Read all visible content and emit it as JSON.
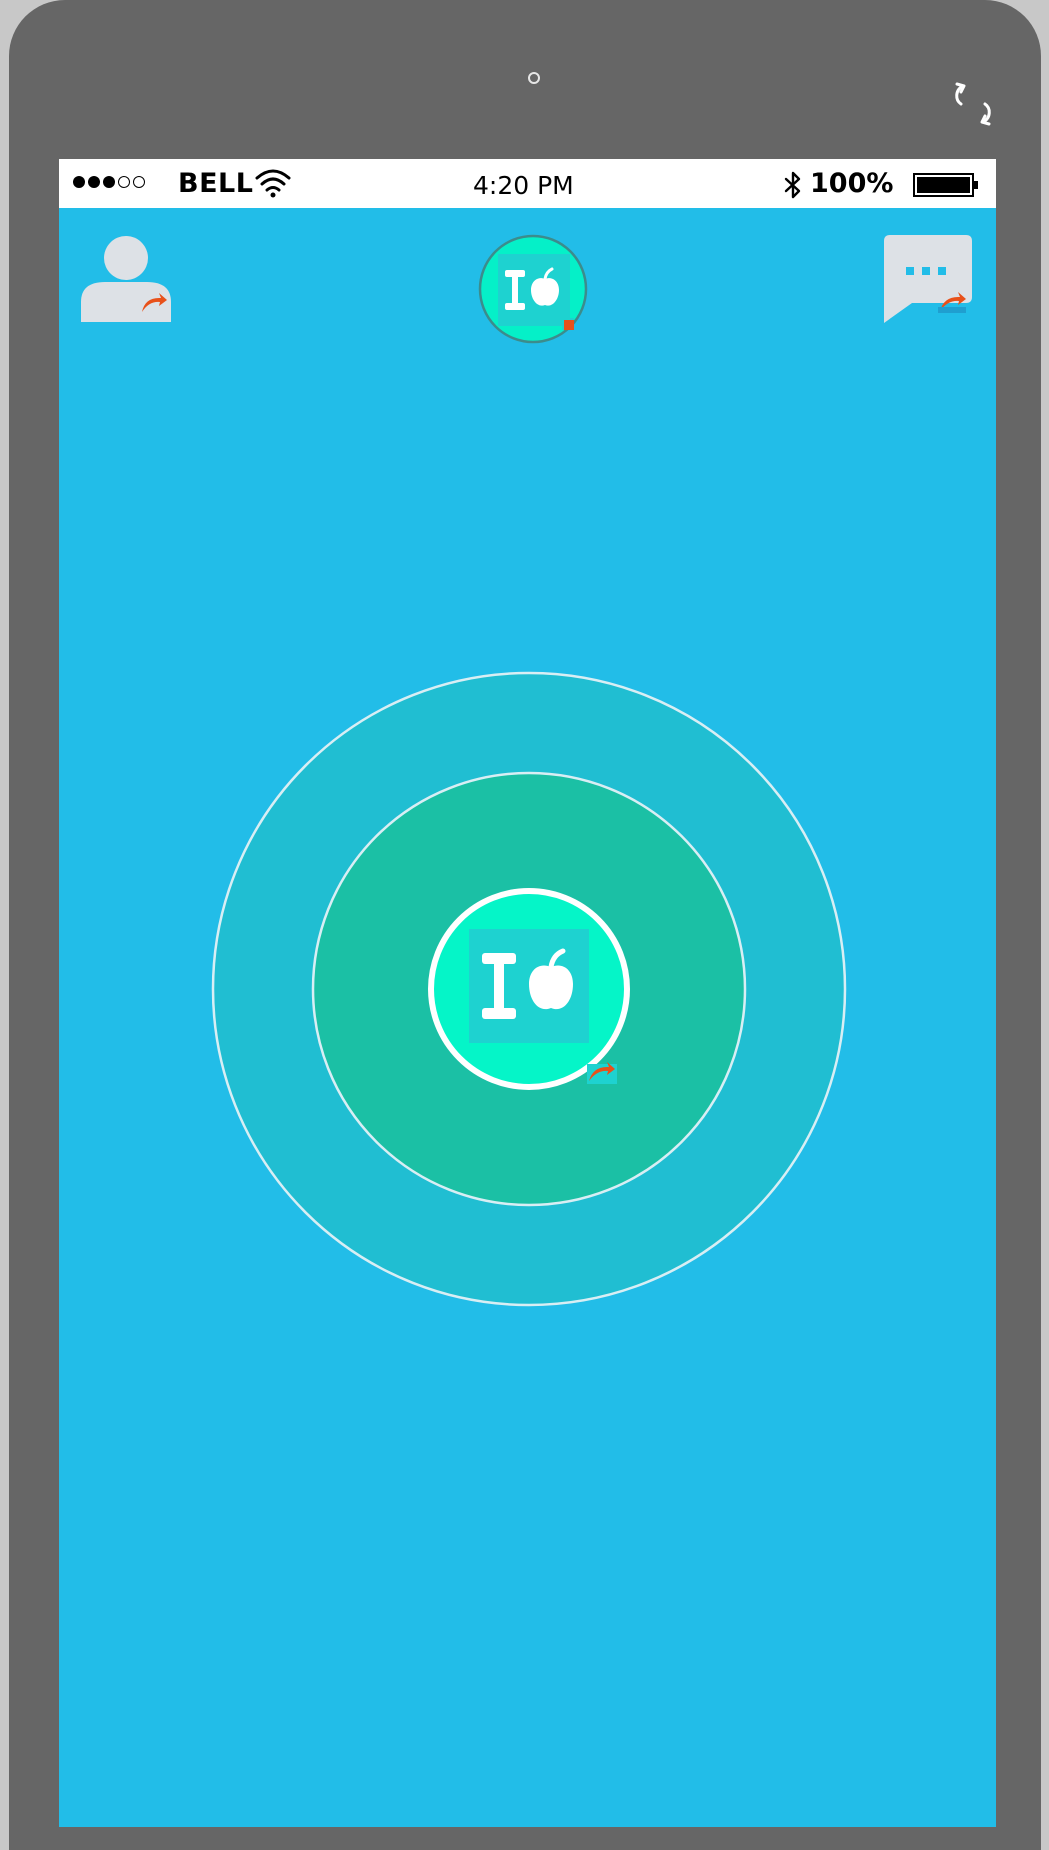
{
  "status_bar": {
    "signal_dots": [
      true,
      true,
      true,
      false,
      false
    ],
    "carrier": "BELL",
    "time": "4:20 PM",
    "battery_percent": "100%",
    "icons": [
      "wifi-icon",
      "bluetooth-icon",
      "battery-icon"
    ]
  },
  "header": {
    "left_icon": "profile-icon",
    "center_icon": "fitness-logo-icon",
    "right_icon": "chat-icon"
  },
  "main": {
    "center_icon": "fitness-logo-icon",
    "rings": 3
  },
  "device": {
    "icons": [
      "camera-icon",
      "rotate-icon"
    ]
  },
  "colors": {
    "device_frame": "#666666",
    "screen_bg": "#22bde8",
    "outer_ring": "#20bed2",
    "middle_ring": "#1bc0a5",
    "center_circle": "#05f5c8",
    "logo_tile": "#1ed2d0",
    "link_arrow": "#e8511a",
    "icon_grey": "#dde1e6"
  }
}
